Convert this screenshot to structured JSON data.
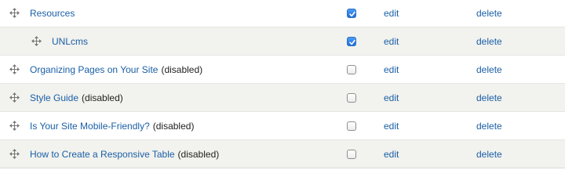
{
  "rows": [
    {
      "title": "Resources",
      "status": "",
      "enabled": true,
      "indent": 0,
      "edit": "edit",
      "delete": "delete"
    },
    {
      "title": "UNLcms",
      "status": "",
      "enabled": true,
      "indent": 1,
      "edit": "edit",
      "delete": "delete"
    },
    {
      "title": "Organizing Pages on Your Site",
      "status": "(disabled)",
      "enabled": false,
      "indent": 0,
      "edit": "edit",
      "delete": "delete"
    },
    {
      "title": "Style Guide",
      "status": "(disabled)",
      "enabled": false,
      "indent": 0,
      "edit": "edit",
      "delete": "delete"
    },
    {
      "title": "Is Your Site Mobile-Friendly?",
      "status": "(disabled)",
      "enabled": false,
      "indent": 0,
      "edit": "edit",
      "delete": "delete"
    },
    {
      "title": "How to Create a Responsive Table",
      "status": "(disabled)",
      "enabled": false,
      "indent": 0,
      "edit": "edit",
      "delete": "delete"
    }
  ],
  "colors": {
    "link": "#1a5fa6",
    "text": "#222222",
    "stripe": "#f2f2ee",
    "checkbox_checked": "#2a7be4"
  },
  "icons": {
    "drag": "move-arrows-icon",
    "check": "checkmark-icon"
  }
}
